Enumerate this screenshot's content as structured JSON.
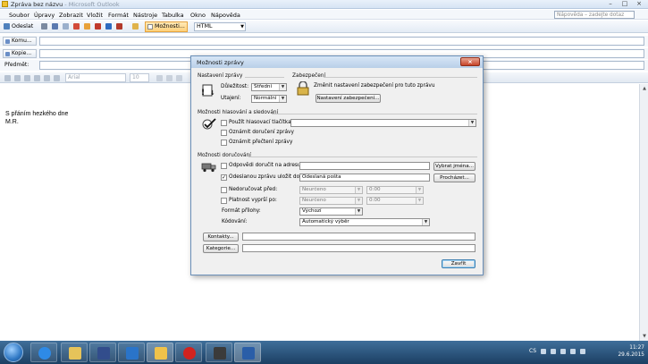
{
  "window": {
    "title": "Zpráva bez názvu",
    "title_suffix": " - Microsoft Outlook",
    "controls": [
      "–",
      "□",
      "×"
    ]
  },
  "menu": [
    "Soubor",
    "Úpravy",
    "Zobrazit",
    "Vložit",
    "Formát",
    "Nástroje",
    "Tabulka",
    "Okno",
    "Nápověda"
  ],
  "help_search": {
    "placeholder": "Nápověda – zadejte dotaz"
  },
  "toolbar": {
    "send_label": "Odeslat",
    "options_label": "Možnosti...",
    "format_value": "HTML"
  },
  "headers": {
    "to_label": "Komu...",
    "cc_label": "Kopie...",
    "subject_label": "Předmět:"
  },
  "format_bar": {
    "font": "Arial",
    "size": "10"
  },
  "body": {
    "line1": "S přáním hezkého dne",
    "line2": "M.R."
  },
  "dialog": {
    "title": "Možnosti zprávy",
    "message_settings": {
      "heading": "Nastavení zprávy",
      "importance_label": "Důležitost:",
      "importance_value": "Střední",
      "sensitivity_label": "Utajení:",
      "sensitivity_value": "Normální"
    },
    "security": {
      "heading": "Zabezpečení",
      "text": "Změnit nastavení zabezpečení pro tuto zprávu",
      "button": "Nastavení zabezpečení..."
    },
    "voting": {
      "heading": "Možnosti hlasování a sledování",
      "use_voting": "Použít hlasovací tlačítka:",
      "delivery_receipt": "Oznámit doručení zprávy",
      "read_receipt": "Oznámit přečtení zprávy"
    },
    "delivery": {
      "heading": "Možnosti doručování",
      "reply_to": "Odpovědi doručit na adresu:",
      "select_names": "Vybrat jména...",
      "save_sent": "Odeslanou zprávu uložit do:",
      "save_sent_value": "Odeslaná pošta",
      "save_sent_checked": true,
      "browse": "Procházet...",
      "no_delivery_before": "Nedoručovat před:",
      "expires_after": "Platnost vyprší po:",
      "date_none": "Neurčeno",
      "time_none": "0:00",
      "attachment_format_label": "Formát přílohy:",
      "attachment_format_value": "Výchozí",
      "encoding_label": "Kódování:",
      "encoding_value": "Automatický výběr"
    },
    "contacts_button": "Kontakty...",
    "categories_button": "Kategorie...",
    "close_button": "Zavřít"
  },
  "taskbar": {
    "language": "CS",
    "time": "11:27",
    "date": "29.6.2015"
  },
  "colors": {
    "accent": "#3c7fb1",
    "taskbar": "#1c3f63",
    "pressed_button": "#ffd07a"
  }
}
